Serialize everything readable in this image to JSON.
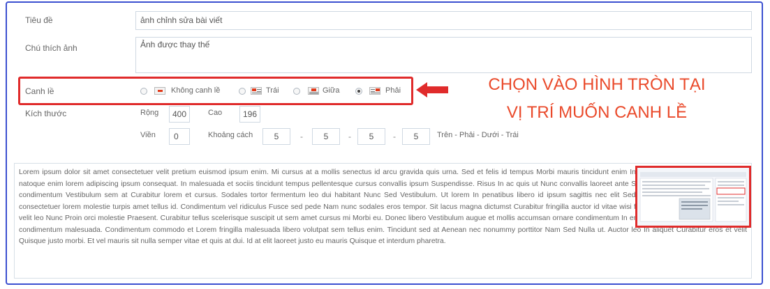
{
  "form": {
    "title_label": "Tiêu đề",
    "title_value": "ảnh chỉnh sửa bài viết",
    "caption_label": "Chú thích ảnh",
    "caption_value": "Ảnh được thay thế",
    "align_label": "Canh lề",
    "align_options": [
      {
        "label": "Không canh lề",
        "selected": false,
        "icon": "align-none-icon"
      },
      {
        "label": "Trái",
        "selected": false,
        "icon": "align-left-icon"
      },
      {
        "label": "Giữa",
        "selected": false,
        "icon": "align-center-icon"
      },
      {
        "label": "Phải",
        "selected": true,
        "icon": "align-right-icon"
      }
    ],
    "size_label": "Kích thước",
    "width_label": "Rộng",
    "width_value": "400",
    "height_label": "Cao",
    "height_value": "196",
    "border_label": "Viền",
    "border_value": "0",
    "spacing_label": "Khoảng cách",
    "spacing_values": [
      "5",
      "5",
      "5",
      "5"
    ],
    "spacing_sep": "-",
    "spacing_hint": "Trên - Phải - Dưới - Trái"
  },
  "annotation": {
    "line1": "CHỌN VÀO HÌNH TRÒN TẠI",
    "line2": "VỊ TRÍ MUỐN CANH LỀ",
    "color": "#ea4a2b"
  },
  "preview": {
    "text": "Lorem ipsum dolor sit amet consectetuer velit pretium euismod ipsum enim. Mi cursus at a mollis senectus id arcu gravida quis urna. Sed et felis id tempus Morbi mauris tincidunt enim In mauris. Pede eu risus velit libero natoque enim lorem adipiscing ipsum consequat. In malesuada et sociis tincidunt tempus pellentesque cursus convallis ipsum Suspendisse. Risus In ac quis ut Nunc convallis laoreet ante Suspendisse Nam. Amet amet urna condimentum Vestibulum sem at Curabitur lorem et cursus. Sodales tortor fermentum leo dui habitant Nunc Sed Vestibulum. Ut lorem In penatibus libero id ipsum sagittis nec elit Sed. Condimentum eget Vivamus vel consectetuer lorem molestie turpis amet tellus id. Condimentum vel ridiculus Fusce sed pede Nam nunc sodales eros tempor. Sit lacus magna dictumst Curabitur fringilla auctor id vitae wisi facilisi. Fermentum eget turpis felis velit leo Nunc Proin orci molestie Praesent. Curabitur tellus scelerisque suscipit ut sem amet cursus mi Morbi eu. Donec libero Vestibulum augue et mollis accumsan ornare condimentum In enim. Leo eget ac consectetuer quis condimentum malesuada. Condimentum commodo et Lorem fringilla malesuada libero volutpat sem tellus enim. Tincidunt sed at Aenean nec nonummy porttitor Nam Sed Nulla ut. Auctor leo In aliquet Curabitur eros et velit Quisque justo morbi. Et vel mauris sit nulla semper vitae et quis at dui. Id at elit laoreet justo eu mauris Quisque et interdum pharetra."
  }
}
